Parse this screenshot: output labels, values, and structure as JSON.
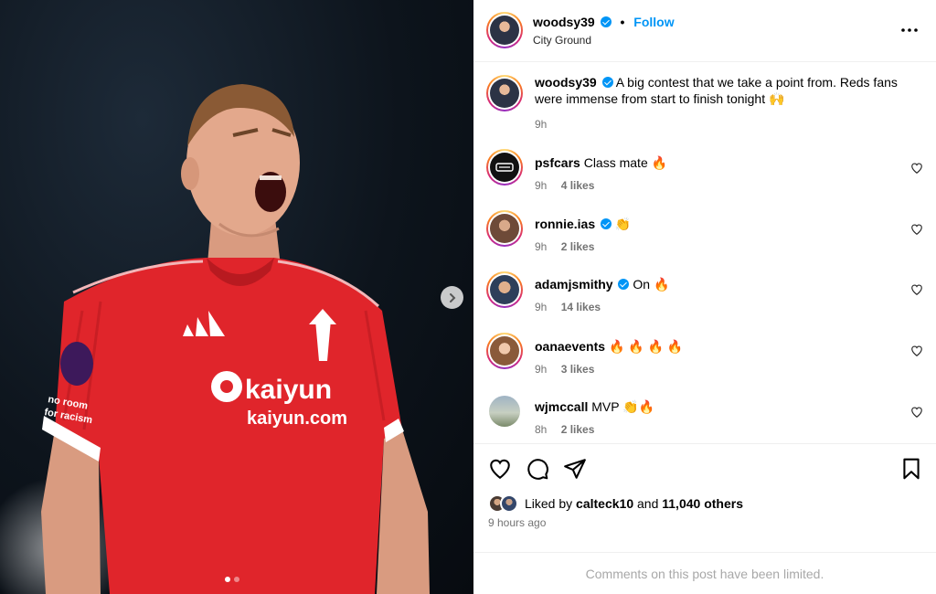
{
  "post": {
    "author": "woodsy39",
    "separator": "•",
    "follow_label": "Follow",
    "location": "City Ground",
    "caption_user": "woodsy39",
    "caption": "A big contest that we take a point from. Reds fans were immense from start to finish tonight 🙌",
    "caption_time": "9h",
    "kit_sponsor": "kaiyun",
    "kit_sponsor_url": "kaiyun.com",
    "sleeve_text_1": "no room",
    "sleeve_text_2": "for racism"
  },
  "comments": [
    {
      "user": "psfcars",
      "verified": false,
      "text": "Class mate 🔥",
      "time": "9h",
      "likes": "4 likes"
    },
    {
      "user": "ronnie.ias",
      "verified": true,
      "text": "👏",
      "time": "9h",
      "likes": "2 likes"
    },
    {
      "user": "adamjsmithy",
      "verified": true,
      "text": "On 🔥",
      "time": "9h",
      "likes": "14 likes"
    },
    {
      "user": "oanaevents",
      "verified": false,
      "text": "🔥 🔥 🔥 🔥",
      "time": "9h",
      "likes": "3 likes"
    },
    {
      "user": "wjmccall",
      "verified": false,
      "text": "MVP 👏🔥",
      "time": "8h",
      "likes": "2 likes"
    }
  ],
  "engagement": {
    "liked_by_prefix": "Liked by",
    "liked_by_user": "calteck10",
    "and_word": "and",
    "others": "11,040 others",
    "timestamp": "9 hours ago",
    "comments_limited": "Comments on this post have been limited."
  },
  "carousel": {
    "total_slides": 2,
    "current_slide": 1
  },
  "icons": {
    "more": "more-horizontal-icon",
    "like": "heart-icon",
    "comment": "comment-bubble-icon",
    "share": "paper-plane-icon",
    "save": "bookmark-icon",
    "next": "chevron-right-icon"
  },
  "colors": {
    "accent": "#0095f6",
    "kit_red": "#e0252b",
    "muted": "#737373"
  }
}
